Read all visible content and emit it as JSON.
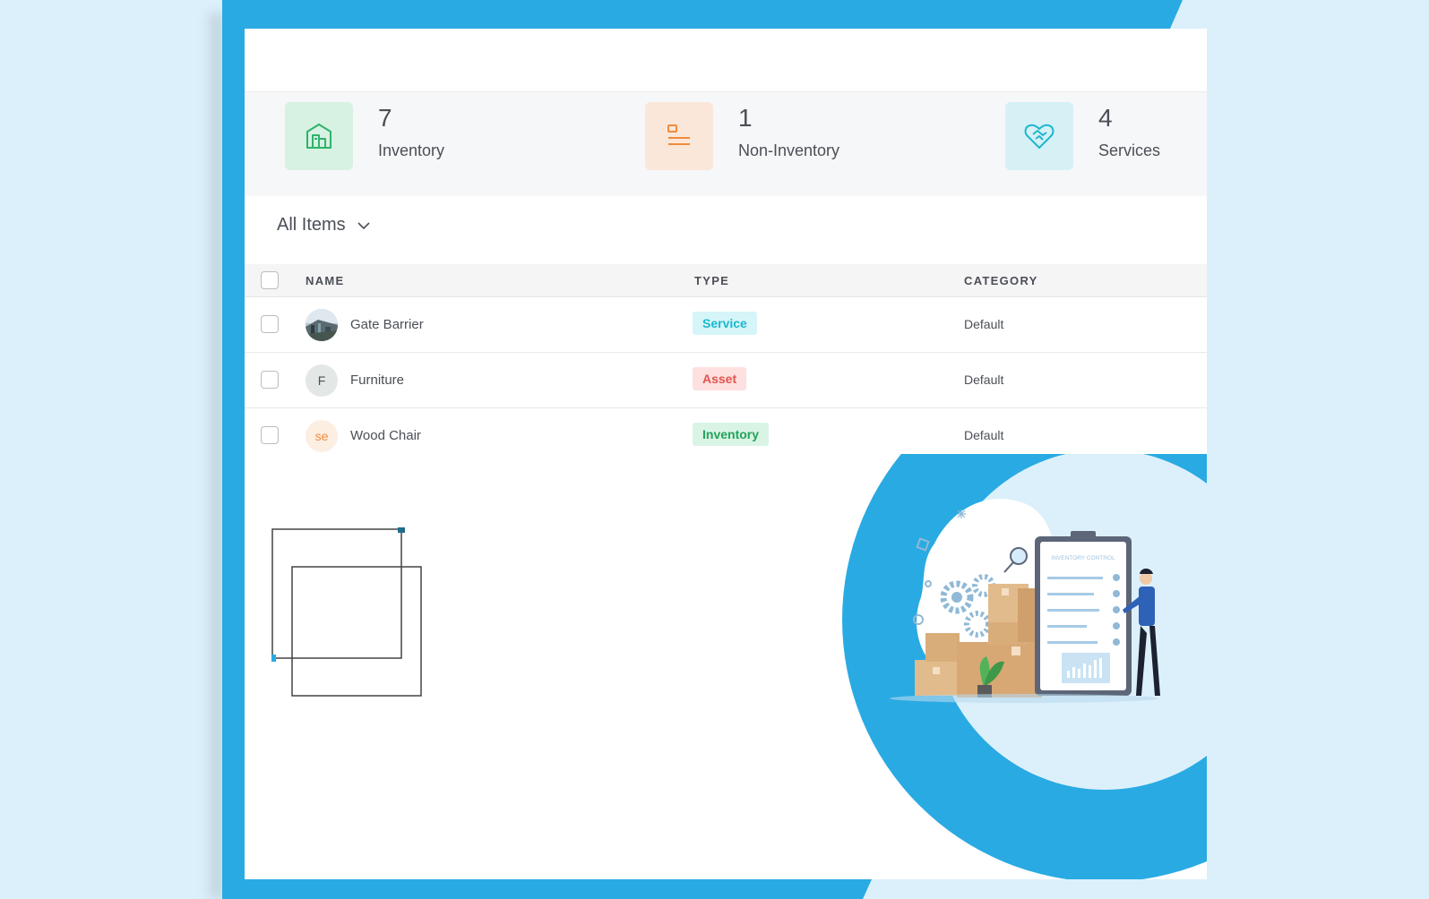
{
  "stats": [
    {
      "count": "7",
      "label": "Inventory",
      "icon": "building-icon",
      "bg": "#d7f1e3",
      "fg": "#2fb36a"
    },
    {
      "count": "1",
      "label": "Non-Inventory",
      "icon": "list-icon",
      "bg": "#fbe7d9",
      "fg": "#f08a3c"
    },
    {
      "count": "4",
      "label": "Services",
      "icon": "handshake-heart-icon",
      "bg": "#d5f1f6",
      "fg": "#1fb6cf"
    }
  ],
  "view_selector": {
    "label": "All Items"
  },
  "table": {
    "headers": {
      "name": "NAME",
      "type": "TYPE",
      "category": "CATEGORY"
    },
    "rows": [
      {
        "name": "Gate Barrier",
        "avatar": "",
        "avatar_kind": "photo",
        "type": "Service",
        "type_bg": "#d5f5f8",
        "type_fg": "#1cb8cf",
        "category": "Default"
      },
      {
        "name": "Furniture",
        "avatar": "F",
        "avatar_kind": "initial",
        "avatar_bg": "#e3e8e6",
        "avatar_fg": "#4b4f56",
        "type": "Asset",
        "type_bg": "#fde0df",
        "type_fg": "#e0554f",
        "category": "Default"
      },
      {
        "name": "Wood Chair",
        "avatar": "se",
        "avatar_kind": "initial",
        "avatar_bg": "#fdeee2",
        "avatar_fg": "#f08a3c",
        "type": "Inventory",
        "type_bg": "#d9f4e5",
        "type_fg": "#23a35a",
        "category": "Default"
      }
    ]
  },
  "illustration": {
    "clipboard_title": "INVENTORY CONTROL"
  },
  "colors": {
    "frame": "#29aae3",
    "page_bg": "#dcf0fb"
  }
}
